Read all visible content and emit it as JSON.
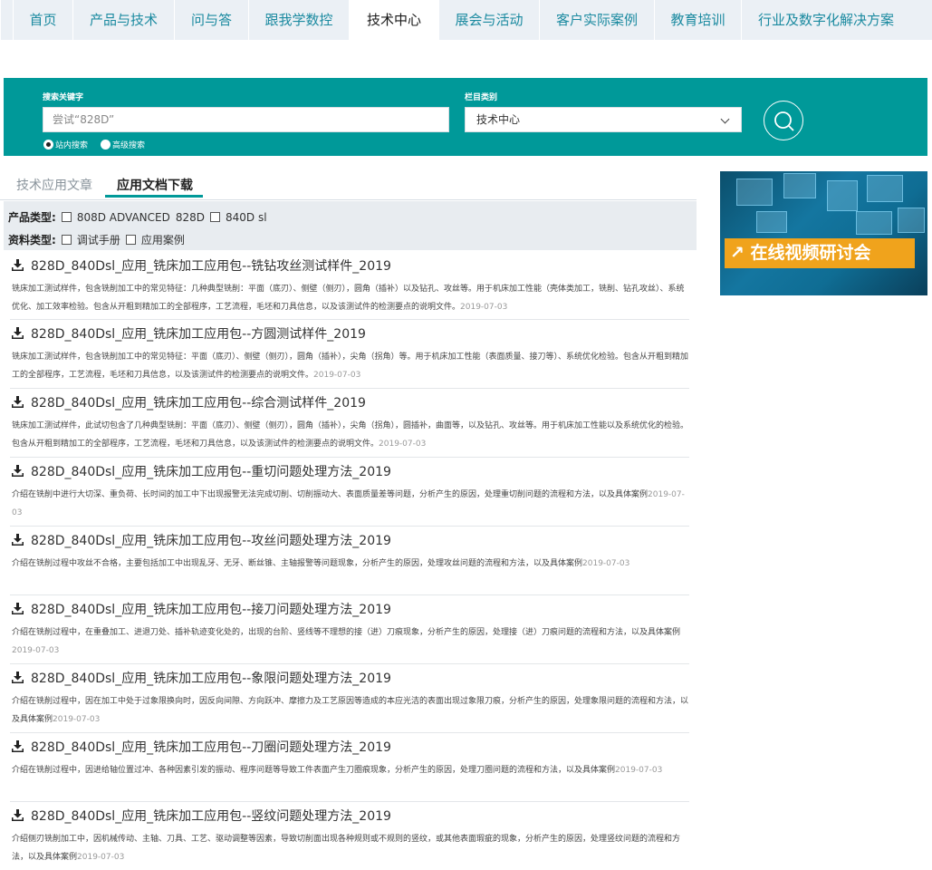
{
  "nav": {
    "items": [
      "首页",
      "产品与技术",
      "问与答",
      "跟我学数控",
      "技术中心",
      "展会与活动",
      "客户实际案例",
      "教育培训",
      "行业及数字化解决方案"
    ],
    "active": "技术中心"
  },
  "search": {
    "keyword_label": "搜索关键字",
    "keyword_placeholder": "尝试“828D”",
    "category_label": "栏目类别",
    "category_value": "技术中心",
    "radio_site": "站内搜索",
    "radio_advanced": "高级搜索"
  },
  "tabs": {
    "articles": "技术应用文章",
    "downloads": "应用文档下载"
  },
  "filters": {
    "product_label": "产品类型:",
    "products": [
      "808D ADVANCED",
      "828D",
      "840D sl"
    ],
    "doc_label": "资料类型:",
    "doc_types": [
      "调试手册",
      "应用案例"
    ]
  },
  "banner": {
    "cta": "↗ 在线视频研讨会"
  },
  "documents": [
    {
      "title": "828D_840Dsl_应用_铣床加工应用包--铣钻攻丝测试样件_2019",
      "desc": "铣床加工测试样件，包含铣削加工中的常见特征：几种典型铣削：平面（底刃）、侧壁（侧刃），圆角（插补）以及钻孔、攻丝等。用于机床加工性能（壳体类加工，铣削、钻孔攻丝）、系统优化、加工效率检验。包含从开粗到精加工的全部程序，工艺流程，毛坯和刀具信息，以及该测试件的检测要点的说明文件。",
      "date": "2019-07-03"
    },
    {
      "title": "828D_840Dsl_应用_铣床加工应用包--方圆测试样件_2019",
      "desc": "铣床加工测试样件，包含铣削加工中的常见特征：平面（底刃）、侧壁（侧刃），圆角（插补），尖角（拐角）等。用于机床加工性能（表面质量、接刀等）、系统优化检验。包含从开粗到精加工的全部程序，工艺流程，毛坯和刀具信息，以及该测试件的检测要点的说明文件。",
      "date": "2019-07-03"
    },
    {
      "title": "828D_840Dsl_应用_铣床加工应用包--综合测试样件_2019",
      "desc": "铣床加工测试样件，此试切包含了几种典型铣削：平面（底刃）、侧壁（侧刃），圆角（插补），尖角（拐角），圆插补，曲面等，以及钻孔、攻丝等。用于机床加工性能以及系统优化的检验。包含从开粗到精加工的全部程序，工艺流程，毛坯和刀具信息，以及该测试件的检测要点的说明文件。",
      "date": "2019-07-03"
    },
    {
      "title": "828D_840Dsl_应用_铣床加工应用包--重切问题处理方法_2019",
      "desc": "介绍在铣削中进行大切深、重负荷、长时间的加工中下出现报警无法完成切削、切削振动大、表面质量差等问题，分析产生的原因，处理重切削问题的流程和方法，以及具体案例",
      "date": "2019-07-03"
    },
    {
      "title": "828D_840Dsl_应用_铣床加工应用包--攻丝问题处理方法_2019",
      "desc": "介绍在铣削过程中攻丝不合格，主要包括加工中出现乱牙、无牙、断丝锥、主轴报警等问题现象，分析产生的原因，处理攻丝问题的流程和方法，以及具体案例",
      "date": "2019-07-03"
    },
    {
      "title": "828D_840Dsl_应用_铣床加工应用包--接刀问题处理方法_2019",
      "desc": "介绍在铣削过程中，在重叠加工、进退刀处、插补轨迹变化处的，出现的台阶、竖线等不理想的接（进）刀痕现象，分析产生的原因，处理接（进）刀痕问题的流程和方法，以及具体案例",
      "date": "2019-07-03"
    },
    {
      "title": "828D_840Dsl_应用_铣床加工应用包--象限问题处理方法_2019",
      "desc": "介绍在铣削过程中，因在加工中处于过象限换向时，因反向间隙、方向跃冲、摩擦力及工艺原因等造成的本应光洁的表面出现过象限刀痕，分析产生的原因，处理象限问题的流程和方法，以及具体案例",
      "date": "2019-07-03"
    },
    {
      "title": "828D_840Dsl_应用_铣床加工应用包--刀圈问题处理方法_2019",
      "desc": "介绍在铣削过程中，因进给轴位置过冲、各种因素引发的振动、程序问题等导致工件表面产生刀圈痕现象，分析产生的原因，处理刀圈问题的流程和方法，以及具体案例",
      "date": "2019-07-03"
    },
    {
      "title": "828D_840Dsl_应用_铣床加工应用包--竖纹问题处理方法_2019",
      "desc": "介绍侧刃铣削加工中，因机械传动、主轴、刀具、工艺、驱动调整等因素，导致切削面出现各种规则或不规则的竖纹，或其他表面瑕疵的现象，分析产生的原因，处理竖纹问题的流程和方法，以及具体案例",
      "date": "2019-07-03"
    }
  ],
  "colors": {
    "accent": "#009999",
    "nav_bg": "#ebf0f5",
    "nav_text": "#1b8aa0",
    "banner_cta": "#f0a31c"
  }
}
